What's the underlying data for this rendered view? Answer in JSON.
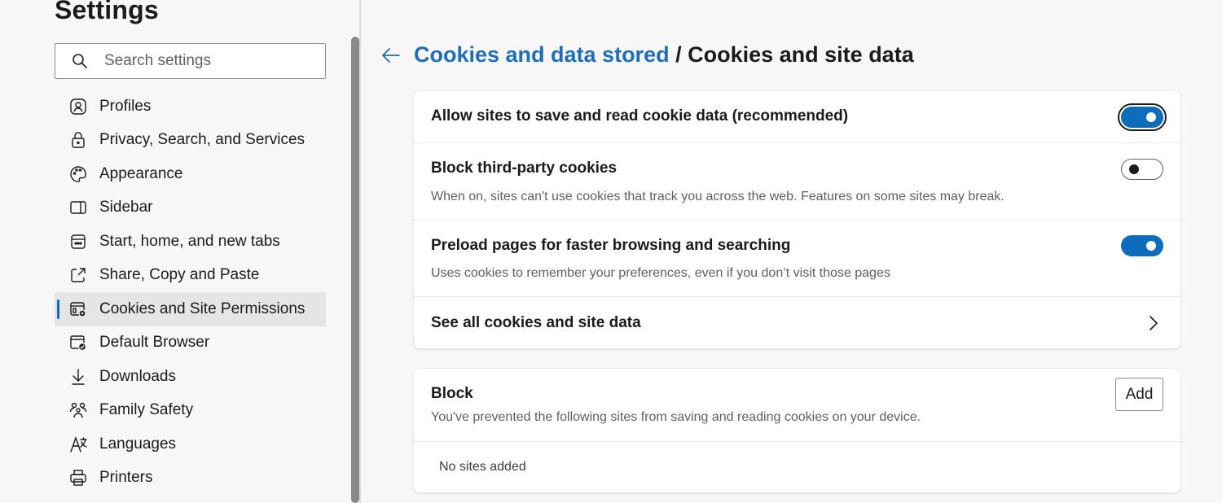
{
  "sidebar": {
    "title": "Settings",
    "search": {
      "placeholder": "Search settings",
      "value": ""
    },
    "items": [
      {
        "label": "Profiles",
        "icon": "profile-icon"
      },
      {
        "label": "Privacy, Search, and Services",
        "icon": "lock-icon"
      },
      {
        "label": "Appearance",
        "icon": "palette-icon"
      },
      {
        "label": "Sidebar",
        "icon": "sidebar-icon"
      },
      {
        "label": "Start, home, and new tabs",
        "icon": "home-tabs-icon"
      },
      {
        "label": "Share, Copy and Paste",
        "icon": "share-icon"
      },
      {
        "label": "Cookies and Site Permissions",
        "icon": "cookies-permissions-icon",
        "active": true
      },
      {
        "label": "Default Browser",
        "icon": "default-browser-icon"
      },
      {
        "label": "Downloads",
        "icon": "download-icon"
      },
      {
        "label": "Family Safety",
        "icon": "family-icon"
      },
      {
        "label": "Languages",
        "icon": "languages-icon"
      },
      {
        "label": "Printers",
        "icon": "printer-icon"
      }
    ]
  },
  "header": {
    "back_icon": "back-arrow-icon",
    "parent_link": "Cookies and data stored",
    "separator": "/",
    "current": "Cookies and site data"
  },
  "cookie_settings": {
    "allow_cookies": {
      "title": "Allow sites to save and read cookie data (recommended)",
      "enabled": true
    },
    "block_third_party": {
      "title": "Block third-party cookies",
      "description": "When on, sites can't use cookies that track you across the web. Features on some sites may break.",
      "enabled": false
    },
    "preload_pages": {
      "title": "Preload pages for faster browsing and searching",
      "description": "Uses cookies to remember your preferences, even if you don’t visit those pages",
      "enabled": true
    },
    "see_all": {
      "title": "See all cookies and site data",
      "icon": "chevron-right-icon"
    }
  },
  "block_section": {
    "title": "Block",
    "description": "You've prevented the following sites from saving and reading cookies on your device.",
    "add_label": "Add",
    "empty_text": "No sites added"
  },
  "colors": {
    "accent": "#0f6cbd",
    "link": "#1f6eb7",
    "active_item_bg": "#e5e5e5"
  }
}
